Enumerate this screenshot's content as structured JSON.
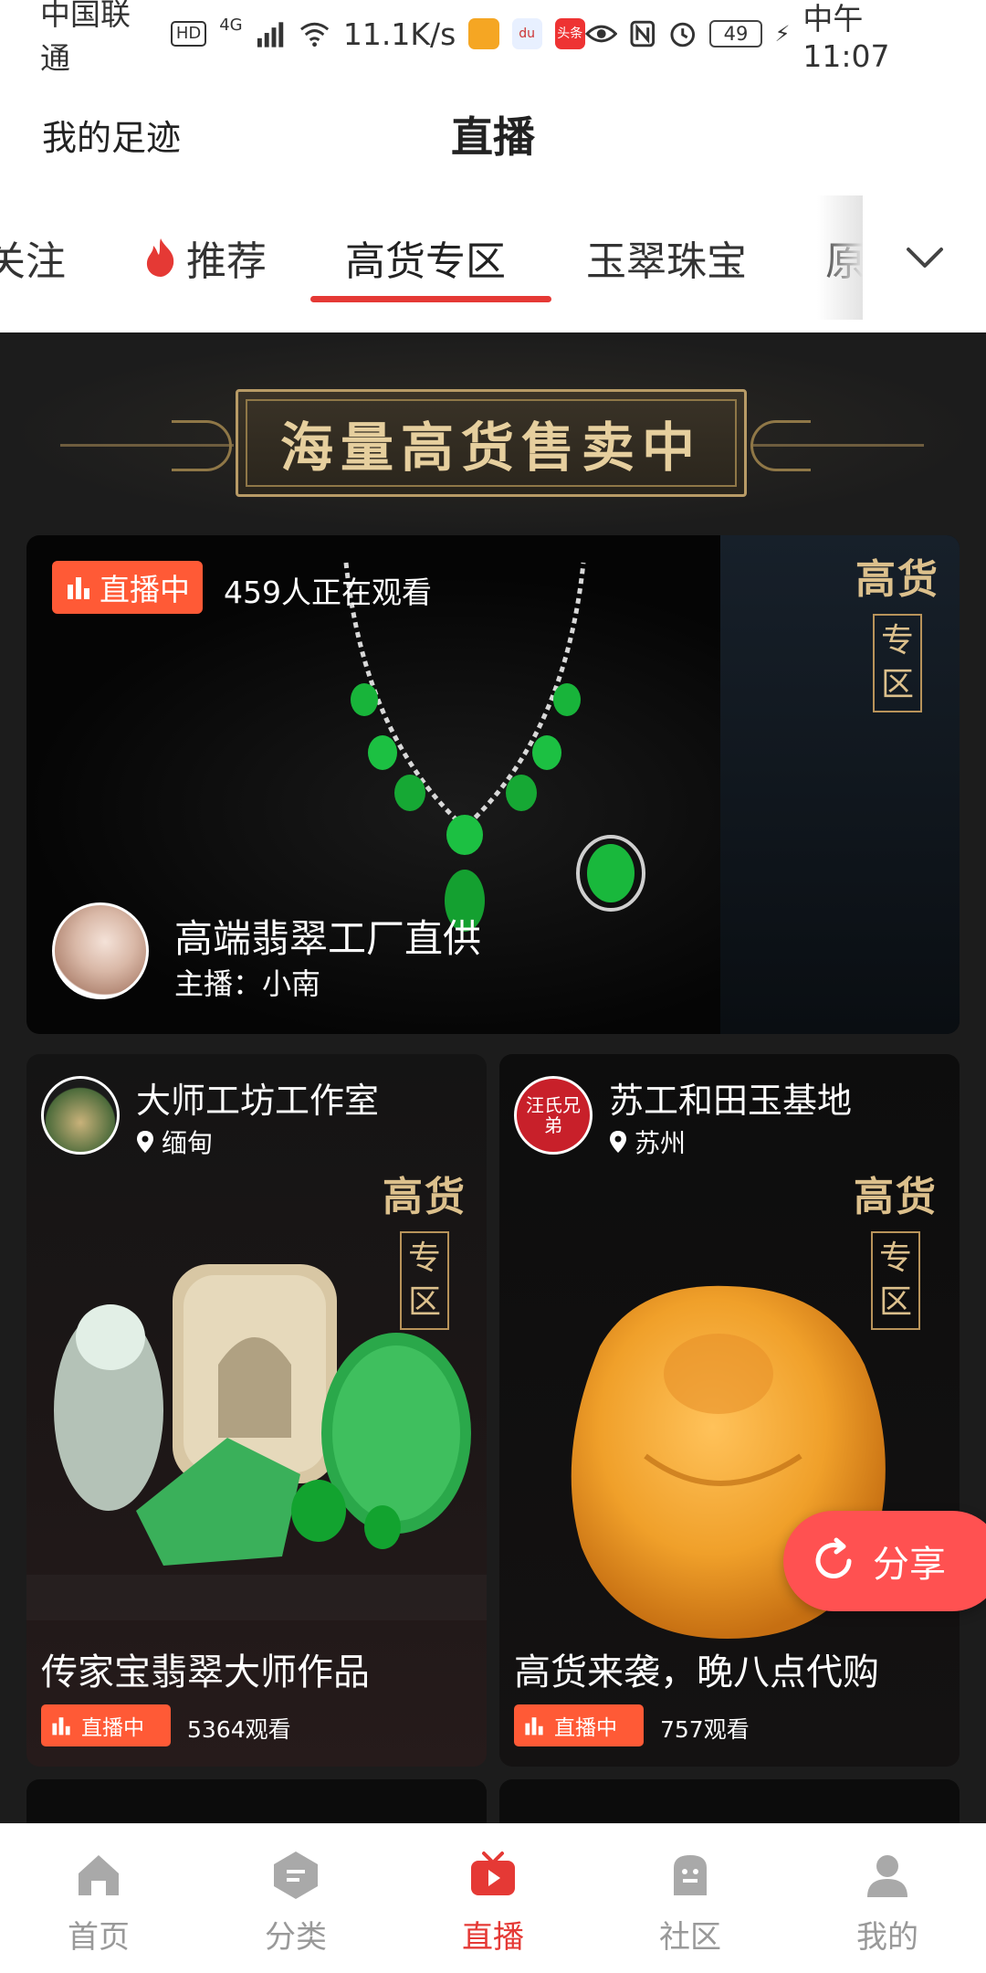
{
  "status_bar": {
    "carrier": "中国联通",
    "hd": "HD",
    "network": "4G",
    "speed": "11.1K/s",
    "app_badge_2": "du",
    "app_badge_3": "头条",
    "battery": "49",
    "time": "中午11:07"
  },
  "header": {
    "left_link": "我的足迹",
    "title": "直播"
  },
  "tabs": [
    {
      "label": "关注"
    },
    {
      "label": "推荐"
    },
    {
      "label": "高货专区"
    },
    {
      "label": "玉翠珠宝"
    },
    {
      "label": "原"
    }
  ],
  "banner": {
    "text": "海量高货售卖中"
  },
  "seal": {
    "top": "高货",
    "line1": "专",
    "line2": "区"
  },
  "hero": {
    "live_label": "直播中",
    "viewers": "459人正在观看",
    "title": "高端翡翠工厂直供",
    "host": "主播：小南"
  },
  "cards": [
    {
      "shop": "大师工坊工作室",
      "location": "缅甸",
      "title": "传家宝翡翠大师作品",
      "live_label": "直播中",
      "views": "5364观看"
    },
    {
      "shop": "苏工和田玉基地",
      "location": "苏州",
      "avatar_text": "汪氏兄弟",
      "title": "高货来袭，晚八点代购",
      "live_label": "直播中",
      "views": "757观看"
    }
  ],
  "share": {
    "label": "分享"
  },
  "nav": [
    {
      "label": "首页",
      "icon": "home-icon"
    },
    {
      "label": "分类",
      "icon": "category-icon"
    },
    {
      "label": "直播",
      "icon": "live-tv-icon"
    },
    {
      "label": "社区",
      "icon": "community-icon"
    },
    {
      "label": "我的",
      "icon": "profile-icon"
    }
  ],
  "colors": {
    "accent": "#e53935",
    "live_badge": "#ff5a36",
    "share_fab": "#ff5151",
    "gold": "#dcc08c",
    "content_bg": "#1c1c1c"
  }
}
